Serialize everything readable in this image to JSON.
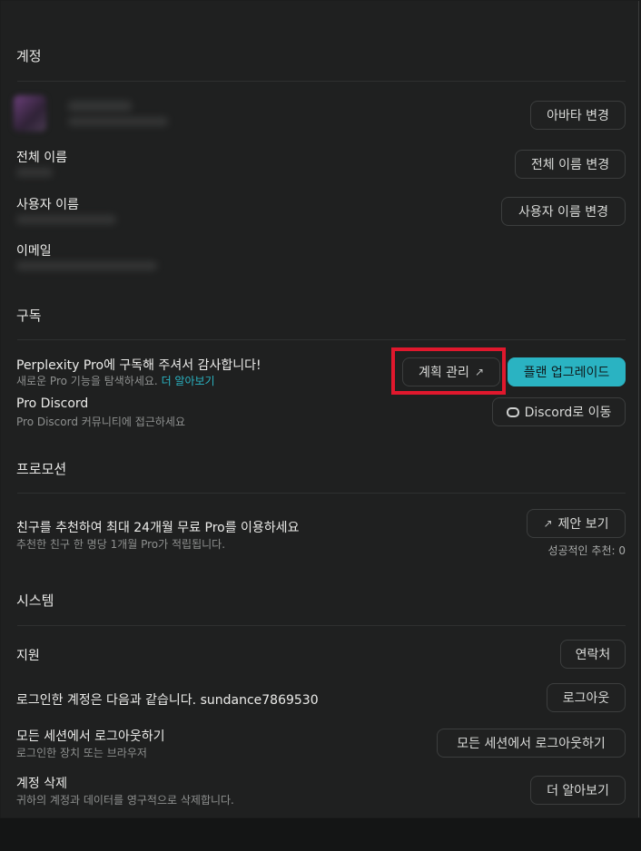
{
  "sections": {
    "account": "계정",
    "subscription": "구독",
    "promotion": "프로모션",
    "system": "시스템"
  },
  "account": {
    "change_avatar": "아바타 변경",
    "full_name_label": "전체 이름",
    "change_full_name": "전체 이름 변경",
    "username_label": "사용자 이름",
    "change_username": "사용자 이름 변경",
    "email_label": "이메일"
  },
  "subscription": {
    "thanks": "Perplexity Pro에 구독해 주셔서 감사합니다!",
    "explore": "새로운 Pro 기능을 탐색하세요.",
    "learn_more": "더 알아보기",
    "manage_plan": "계획 관리",
    "upgrade_plan": "플랜 업그레이드",
    "discord_title": "Pro Discord",
    "discord_sub": "Pro Discord 커뮤니티에 접근하세요",
    "discord_button": "Discord로 이동"
  },
  "promotion": {
    "title": "친구를 추천하여 최대 24개월 무료 Pro를 이용하세요",
    "sub": "추천한 친구 한 명당 1개월 Pro가 적립됩니다.",
    "view_offer": "제안 보기",
    "successful": "성공적인 추천: 0"
  },
  "system": {
    "support": "지원",
    "contact": "연락처",
    "logged_in": "로그인한 계정은 다음과 같습니다. sundance7869530",
    "logout": "로그아웃",
    "logout_all_title": "모든 세션에서 로그아웃하기",
    "logout_all_sub": "로그인한 장치 또는 브라우저",
    "logout_all_button": "모든 세션에서 로그아웃하기",
    "delete_title": "계정 삭제",
    "delete_sub": "귀하의 계정과 데이터를 영구적으로 삭제합니다.",
    "learn_more_button": "더 알아보기"
  },
  "colors": {
    "accent": "#2ab3c2",
    "highlight": "#e0182d",
    "background": "#1f2020"
  }
}
